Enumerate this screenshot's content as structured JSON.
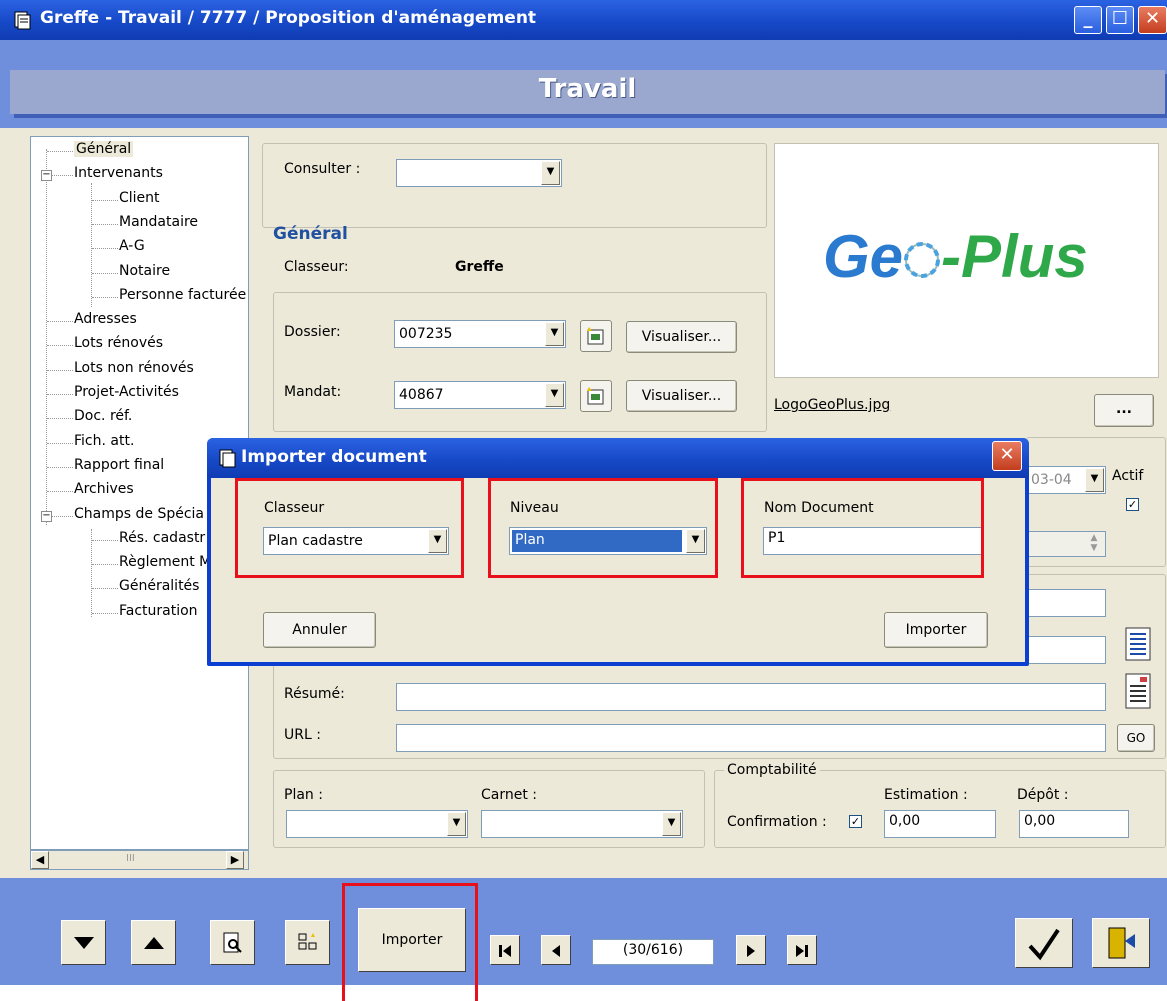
{
  "window": {
    "title": "Greffe - Travail / 7777 / Proposition d'aménagement",
    "banner": "Travail"
  },
  "tree": {
    "items": [
      {
        "label": "Général",
        "level": 1,
        "selected": true
      },
      {
        "label": "Intervenants",
        "level": 1,
        "expander": "−"
      },
      {
        "label": "Client",
        "level": 2
      },
      {
        "label": "Mandataire",
        "level": 2
      },
      {
        "label": "A-G",
        "level": 2
      },
      {
        "label": "Notaire",
        "level": 2
      },
      {
        "label": "Personne facturée",
        "level": 2
      },
      {
        "label": "Adresses",
        "level": 1
      },
      {
        "label": "Lots rénovés",
        "level": 1
      },
      {
        "label": "Lots non rénovés",
        "level": 1
      },
      {
        "label": "Projet-Activités",
        "level": 1
      },
      {
        "label": "Doc. réf.",
        "level": 1
      },
      {
        "label": "Fich. att.",
        "level": 1
      },
      {
        "label": "Rapport final",
        "level": 1
      },
      {
        "label": "Archives",
        "level": 1
      },
      {
        "label": "Champs de Spécia",
        "level": 1,
        "expander": "−"
      },
      {
        "label": "Rés. cadastr",
        "level": 2
      },
      {
        "label": "Règlement M",
        "level": 2
      },
      {
        "label": "Généralités",
        "level": 2
      },
      {
        "label": "Facturation",
        "level": 2
      }
    ],
    "scroll_mid": "III"
  },
  "form": {
    "consulter_label": "Consulter :",
    "consulter_value": "",
    "section_title": "Général",
    "classeur_label": "Classeur:",
    "classeur_value": "Greffe",
    "dossier_label": "Dossier:",
    "dossier_value": "007235",
    "mandat_label": "Mandat:",
    "mandat_value": "40867",
    "visualiser_label": "Visualiser...",
    "date_partial": "03-04",
    "actif_label": "Actif",
    "resume_label": "Résumé:",
    "url_label": "URL :",
    "go_label": "GO",
    "plan_label": "Plan :",
    "carnet_label": "Carnet :",
    "comptabilite_label": "Comptabilité",
    "confirmation_label": "Confirmation :",
    "estimation_label": "Estimation :",
    "estimation_value": "0,00",
    "depot_label": "Dépôt :",
    "depot_value": "0,00"
  },
  "logo": {
    "brand_text_a": "Ge",
    "brand_text_b": "-Plus",
    "filename": "LogoGeoPlus.jpg",
    "browse_label": "..."
  },
  "toolbar": {
    "importer_label": "Importer",
    "record_position": "(30/616)"
  },
  "dialog": {
    "title": "Importer document",
    "classeur_label": "Classeur",
    "classeur_value": "Plan cadastre",
    "niveau_label": "Niveau",
    "niveau_value": "Plan",
    "nom_label": "Nom Document",
    "nom_value": "P1",
    "cancel_label": "Annuler",
    "import_label": "Importer"
  },
  "colors": {
    "highlight": "#e8101a",
    "title_bar": "#1749c7",
    "window_blue": "#6f8fdc",
    "panel_bg": "#ece9d8",
    "section_title": "#2050a0"
  }
}
